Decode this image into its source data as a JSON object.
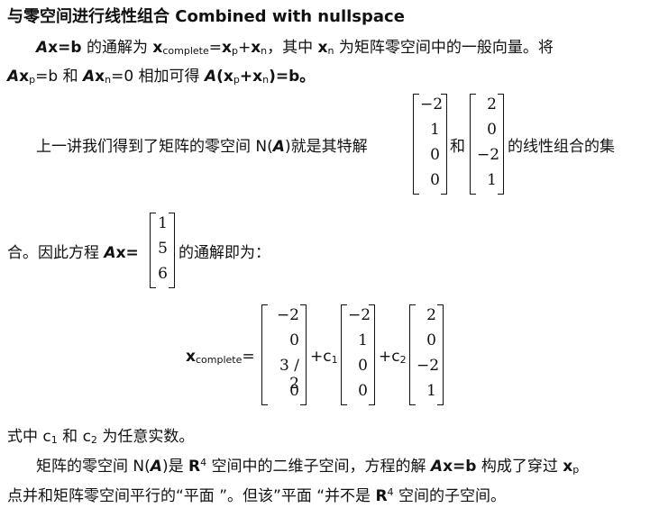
{
  "title": "与零空间进行线性组合 Combined with nullspace",
  "line1": {
    "part_a": "A",
    "part_b": "x=b",
    "part_c": " 的通解为 ",
    "xc": "x",
    "xc_sub": "complete",
    "eq": "=",
    "xp": "x",
    "p": "p",
    "plus": "+",
    "xn": "x",
    "n": "n",
    "part_d": "，其中 ",
    "xn2": "x",
    "n2": "n",
    "part_e": " 为矩阵零空间中的一般向量。将"
  },
  "line2": {
    "a1": "A",
    "x1": "x",
    "p": "p",
    "eq1": "=b 和 ",
    "a2": "A",
    "x2": "x",
    "n": "n",
    "eq2": "=0 相加可得 ",
    "a3": "A",
    "paren": "(x",
    "p2": "p",
    "plus": "+x",
    "n2": "n",
    "end": ")=b。"
  },
  "para2_before": "上一讲我们得到了矩阵的零空间 N(",
  "para2_A": "A",
  "para2_after": ")就是其特解",
  "and_text": "和",
  "para2_end": "的线性组合的集",
  "vec1": [
    "−2",
    "1",
    "0",
    "0"
  ],
  "vec2": [
    "2",
    "0",
    "−2",
    "1"
  ],
  "line4_a": "合。因此方程 ",
  "line4_A": "A",
  "line4_x": "x=",
  "vec_b": [
    "1",
    "5",
    "6"
  ],
  "line4_end": "的通解即为：",
  "sol_lhs": "x",
  "sol_lhs_sub": "complete",
  "sol_eq": "=",
  "sol_vp": [
    "−2",
    "0",
    "3 / 2",
    "0"
  ],
  "sol_c1": "+c",
  "sol_c1_sub": "1",
  "sol_v1": [
    "−2",
    "1",
    "0",
    "0"
  ],
  "sol_c2": "+c",
  "sol_c2_sub": "2",
  "sol_v2": [
    "2",
    "0",
    "−2",
    "1"
  ],
  "line5": {
    "a": "式中 c",
    "s1": "1",
    "b": " 和 c",
    "s2": "2",
    "c": " 为任意实数。"
  },
  "line6": {
    "a": "矩阵的零空间 N(",
    "A": "A",
    "b": ")是 ",
    "R": "R",
    "sup": "4",
    "c": " 空间中的二维子空间，方程的解 ",
    "A2": "A",
    "d": "x=b",
    "e": " 构成了穿过 ",
    "x": "x",
    "p": "p"
  },
  "line7": {
    "a": "点并和矩阵零空间平行的“平面 ”。但该”平面 “并不是 ",
    "R": "R",
    "sup": "4",
    "b": " 空间的子空间。"
  }
}
